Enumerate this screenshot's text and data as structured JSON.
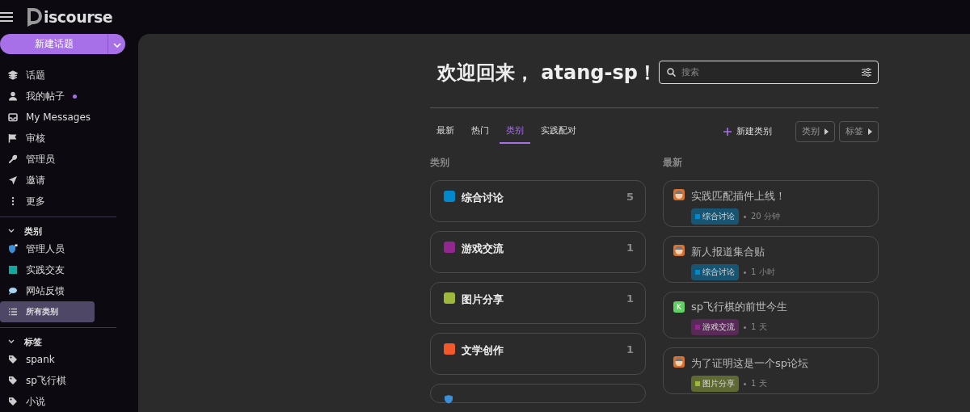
{
  "header": {
    "logo": "iscourse"
  },
  "new_topic_button": "新建话题",
  "sidebar": {
    "items": [
      {
        "label": "话题",
        "kind": "layers",
        "unread": false
      },
      {
        "label": "我的帖子",
        "kind": "user",
        "unread": true
      },
      {
        "label": "My Messages",
        "kind": "inbox",
        "unread": false
      },
      {
        "label": "审核",
        "kind": "flag",
        "unread": false
      },
      {
        "label": "管理员",
        "kind": "wrench",
        "unread": false
      },
      {
        "label": "邀请",
        "kind": "send",
        "unread": false
      },
      {
        "label": "更多",
        "kind": "dots",
        "unread": false
      }
    ],
    "sections": [
      {
        "title": "类别",
        "expanded": true,
        "items": [
          {
            "label": "管理人员",
            "kind": "shield-lock",
            "selected": false
          },
          {
            "label": "实践交友",
            "kind": "square",
            "color": "#12a89d",
            "selected": false
          },
          {
            "label": "网站反馈",
            "kind": "bubble",
            "selected": false
          },
          {
            "label": "所有类别",
            "kind": "list",
            "selected": true
          }
        ]
      },
      {
        "title": "标签",
        "expanded": true,
        "items": [
          {
            "label": "spank",
            "kind": "tag",
            "selected": false
          },
          {
            "label": "sp飞行棋",
            "kind": "tag",
            "selected": false
          },
          {
            "label": "小说",
            "kind": "tag",
            "selected": false
          }
        ]
      }
    ]
  },
  "main": {
    "title": "欢迎回来， atang-sp！",
    "search": {
      "placeholder": "搜索"
    },
    "tabs": [
      {
        "label": "最新",
        "selected": false
      },
      {
        "label": "热门",
        "selected": false
      },
      {
        "label": "类别",
        "selected": true
      },
      {
        "label": "实践配对",
        "selected": false
      }
    ],
    "new_category_button": "新建类别",
    "filters": [
      "类别",
      "标签"
    ],
    "categories_heading": "类别",
    "categories": [
      {
        "name": "综合讨论",
        "color": "#0088cc",
        "count": "5"
      },
      {
        "name": "游戏交流",
        "color": "#92278f",
        "count": "1"
      },
      {
        "name": "图片分享",
        "color": "#9eb83b",
        "count": "1"
      },
      {
        "name": "文学创作",
        "color": "#f1592a",
        "count": "1"
      },
      {
        "kind": "partial"
      }
    ],
    "latest_heading": "最新",
    "topics": [
      {
        "title": "实践匹配插件上线！",
        "category": {
          "name": "综合讨论",
          "color": "#0088cc"
        },
        "age": "20 分钟"
      },
      {
        "title": "新人报道集合贴",
        "category": {
          "name": "综合讨论",
          "color": "#0088cc"
        },
        "age": "1 小时"
      },
      {
        "title": "sp飞行棋的前世今生",
        "avatar": {
          "kind": "letter",
          "letter": "K",
          "color": "#5ed35e"
        },
        "category": {
          "name": "游戏交流",
          "color": "#92278f"
        },
        "age": "1 天"
      },
      {
        "title": "为了证明这是一个sp论坛",
        "category": {
          "name": "图片分享",
          "color": "#9eb83b"
        },
        "age": "1 天"
      }
    ]
  }
}
